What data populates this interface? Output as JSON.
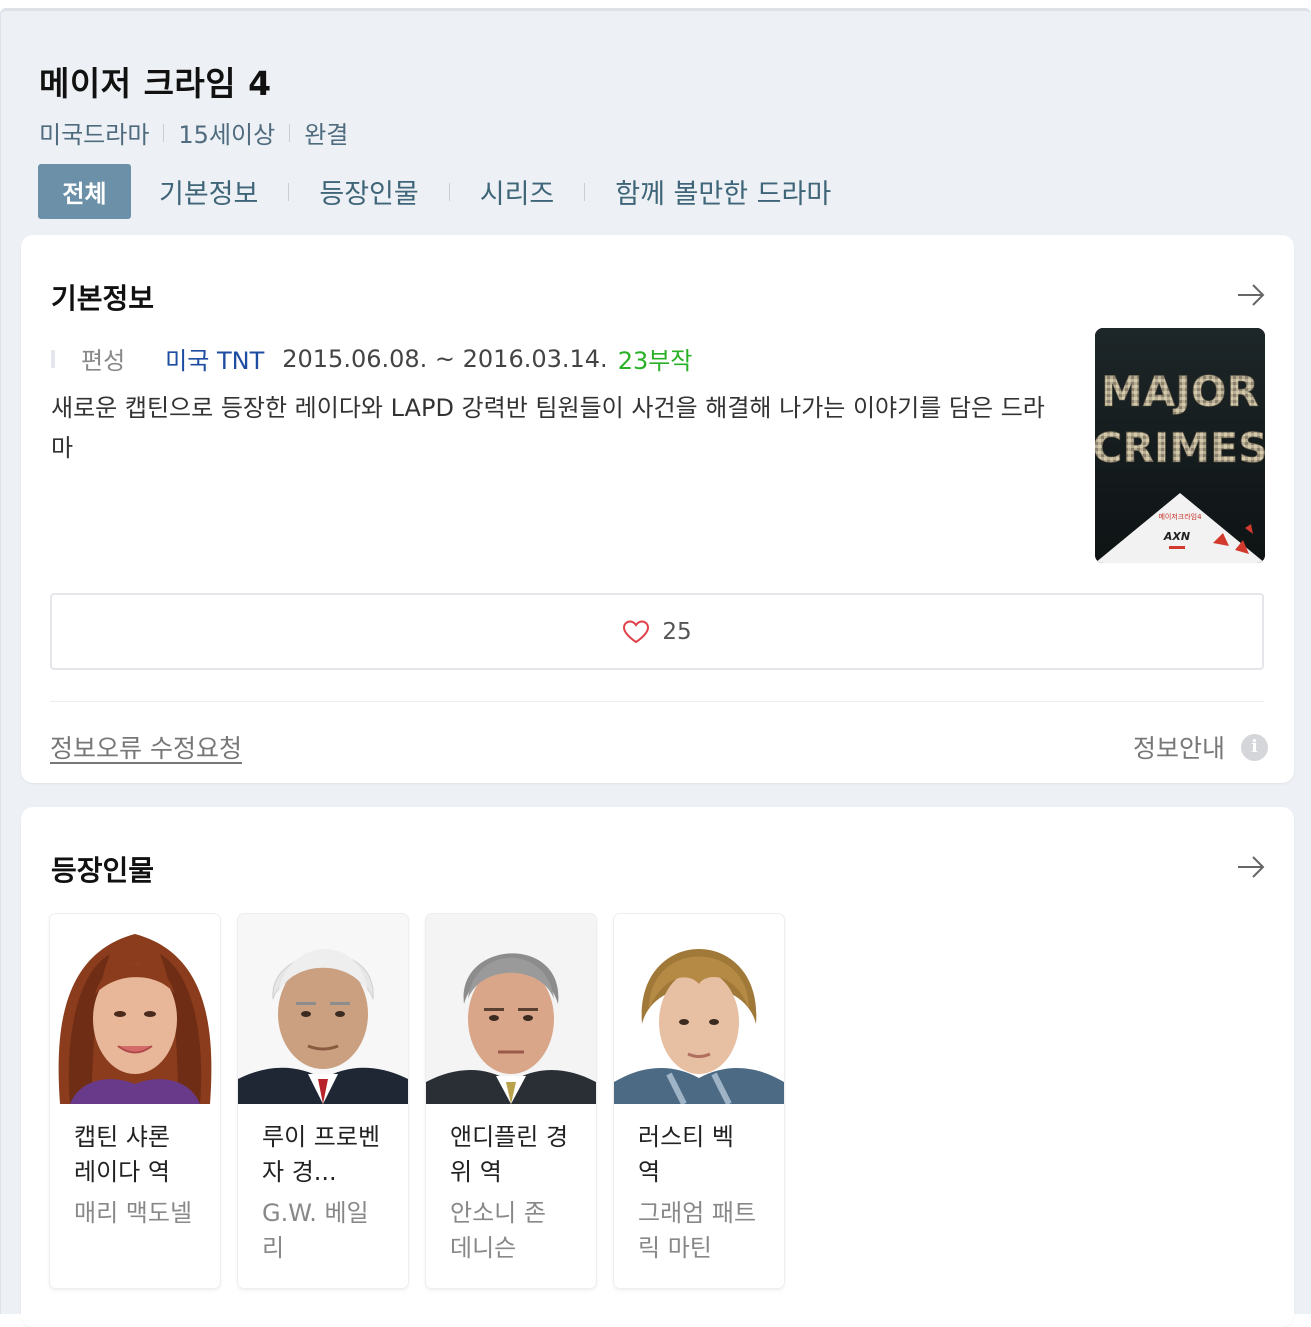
{
  "header": {
    "title": "메이저 크라임 4",
    "meta": [
      "미국드라마",
      "15세이상",
      "완결"
    ]
  },
  "tabs": [
    {
      "label": "전체",
      "active": true
    },
    {
      "label": "기본정보"
    },
    {
      "label": "등장인물"
    },
    {
      "label": "시리즈"
    },
    {
      "label": "함께 볼만한 드라마"
    }
  ],
  "basic_info": {
    "title": "기본정보",
    "broadcast_label": "편성",
    "network": "미국 TNT",
    "date_range": "2015.06.08. ~ 2016.03.14.",
    "episodes": "23부작",
    "description": "새로운 캡틴으로 등장한 레이다와 LAPD 강력반 팀원들이 사건을 해결해 나가는 이야기를 담은 드라마",
    "poster": {
      "line1": "MAJOR",
      "line2": "CRIMES",
      "caption": "메이저크라임4",
      "logo": "AXN"
    },
    "like_count": "25",
    "report_link": "정보오류 수정요청",
    "info_guide": "정보안내"
  },
  "cast": {
    "title": "등장인물",
    "items": [
      {
        "role": "캡틴 샤론 레이다 역",
        "actor": "매리 맥도넬"
      },
      {
        "role": "루이 프로벤자 경...",
        "actor": "G.W. 베일리"
      },
      {
        "role": "앤디플린 경위 역",
        "actor": "안소니 존 데니슨"
      },
      {
        "role": "러스티 벡 역",
        "actor": "그래엄 패트릭 마틴"
      }
    ]
  },
  "colors": {
    "background": "#edf0f4",
    "tab_active": "#6b90a7",
    "link_blue": "#1c4da1",
    "episodes_green": "#29b026",
    "heart": "#e0414a"
  }
}
